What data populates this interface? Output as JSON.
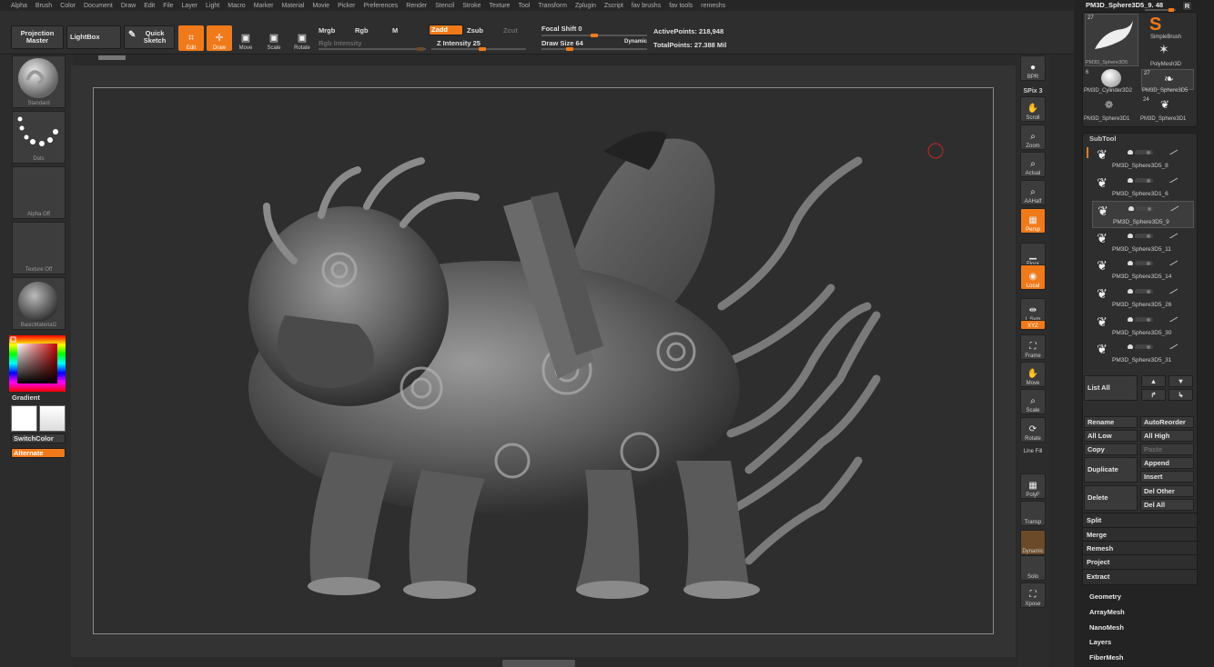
{
  "menu": [
    "Alpha",
    "Brush",
    "Color",
    "Document",
    "Draw",
    "Edit",
    "File",
    "Layer",
    "Light",
    "Macro",
    "Marker",
    "Material",
    "Movie",
    "Picker",
    "Preferences",
    "Render",
    "Stencil",
    "Stroke",
    "Texture",
    "Tool",
    "Transform",
    "Zplugin",
    "Zscript",
    "fav brushs",
    "fav tools",
    "remeshs"
  ],
  "shelf": {
    "projection_master": "Projection Master",
    "lightbox": "LightBox",
    "quick_sketch": "Quick Sketch",
    "edit": "Edit",
    "draw": "Draw",
    "move": "Move",
    "scale": "Scale",
    "rotate": "Rotate",
    "mrgb": "Mrgb",
    "rgb": "Rgb",
    "m": "M",
    "rgb_intensity": "Rgb Intensity",
    "zadd": "Zadd",
    "zsub": "Zsub",
    "zcut": "Zcut",
    "z_intensity": "Z Intensity 25",
    "focal_shift": "Focal Shift 0",
    "draw_size": "Draw Size 64",
    "dynamic": "Dynamic",
    "active_points": "ActivePoints: 218,948",
    "total_points": "TotalPoints: 27.388 Mil"
  },
  "left": {
    "brush": "Standard",
    "stroke": "Dots",
    "alpha": "Alpha Off",
    "texture": "Texture Off",
    "material": "BasicMaterial2",
    "gradient": "Gradient",
    "switch_color": "SwitchColor",
    "alternate": "Alternate"
  },
  "right_tools": [
    {
      "label": "BPR",
      "icon": "sphere-icon"
    },
    {
      "label": "SPix 3",
      "icon": ""
    },
    {
      "label": "Scroll",
      "icon": "hand-icon"
    },
    {
      "label": "Zoom",
      "icon": "magnifier-icon"
    },
    {
      "label": "Actual",
      "icon": "magnifier-icon"
    },
    {
      "label": "AAHalf",
      "icon": "magnifier-icon"
    },
    {
      "label": "Persp",
      "icon": "grid-icon"
    },
    {
      "label": "Floor",
      "icon": "floor-icon"
    },
    {
      "label": "Local",
      "icon": "local-icon"
    },
    {
      "label": "L.Sym",
      "icon": "symmetry-icon"
    },
    {
      "label": "XYZ",
      "icon": ""
    },
    {
      "label": "Frame",
      "icon": "frame-icon"
    },
    {
      "label": "Move",
      "icon": "hand-icon"
    },
    {
      "label": "Scale",
      "icon": "magnifier-icon"
    },
    {
      "label": "Rotate",
      "icon": "rotate-icon"
    },
    {
      "label": "Line Fill",
      "icon": ""
    },
    {
      "label": "PolyF",
      "icon": "grid-icon"
    },
    {
      "label": "Transp",
      "icon": ""
    },
    {
      "label": "Dynamic",
      "icon": ""
    },
    {
      "label": "Solo",
      "icon": ""
    },
    {
      "label": "Xpose",
      "icon": "xpose-icon"
    }
  ],
  "tool_panel": {
    "current_tool": "PM3D_Sphere3D5_9. 48",
    "r_button": "R",
    "tool_thumb_count": "27",
    "tool_thumb_label": "PM3D_Sphere3D5",
    "simple_brush": "SimpleBrush",
    "polymesh": "PolyMesh3D",
    "cylinder_count": "6",
    "cylinder": "PM3D_Cylinder3D2",
    "sphere_count": "27",
    "sphere": "PM3D_Sphere3D5",
    "sphere1_count": "24",
    "sphere1a": "PM3D_Sphere3D1",
    "sphere1b": "PM3D_Sphere3D1"
  },
  "subtool": {
    "title": "SubTool",
    "items": [
      "PM3D_Sphere3D5_8",
      "PM3D_Sphere3D1_6",
      "PM3D_Sphere3D5_9",
      "PM3D_Sphere3D5_11",
      "PM3D_Sphere3D5_14",
      "PM3D_Sphere3D5_26",
      "PM3D_Sphere3D5_30",
      "PM3D_Sphere3D5_31"
    ],
    "list_all": "List All",
    "rename": "Rename",
    "auto_reorder": "AutoReorder",
    "all_low": "All Low",
    "all_high": "All High",
    "copy": "Copy",
    "paste": "Paste",
    "duplicate": "Duplicate",
    "append": "Append",
    "insert": "Insert",
    "delete": "Delete",
    "del_other": "Del Other",
    "del_all": "Del All",
    "split": "Split",
    "merge": "Merge",
    "remesh": "Remesh",
    "project": "Project",
    "extract": "Extract"
  },
  "tool_menus": [
    "Geometry",
    "ArrayMesh",
    "NanoMesh",
    "Layers",
    "FiberMesh"
  ],
  "colors": {
    "accent": "#f07a1a",
    "background": "#2a2a2a"
  }
}
